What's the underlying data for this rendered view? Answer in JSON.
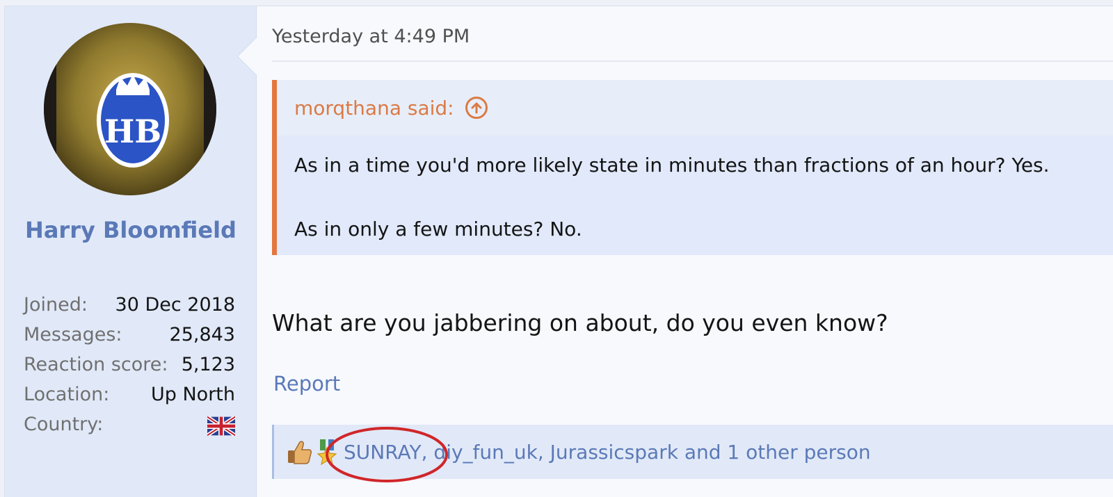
{
  "user": {
    "name": "Harry Bloomfield",
    "stats": [
      {
        "label": "Joined:",
        "value": "30 Dec 2018"
      },
      {
        "label": "Messages:",
        "value": "25,843"
      },
      {
        "label": "Reaction score:",
        "value": "5,123"
      },
      {
        "label": "Location:",
        "value": "Up North"
      },
      {
        "label": "Country:",
        "value": ""
      }
    ],
    "avatar_text": "HB",
    "country_flag": "uk-flag-icon"
  },
  "post": {
    "timestamp": "Yesterday at 4:49 PM",
    "quote": {
      "author_said": "morqthana said:",
      "lines": [
        "As in a time you'd more likely state in minutes than fractions of an hour? Yes.",
        "As in only a few minutes? No."
      ]
    },
    "body": "What are you jabbering on about, do you even know?",
    "report_label": "Report",
    "reactions": {
      "icons": [
        "thumbs-up-icon",
        "medal-icon"
      ],
      "text": "SUNRAY, diy_fun_uk, Jurassicspark and 1 other person"
    }
  },
  "colors": {
    "accent": "#5b79b7",
    "quote_accent": "#e2773f",
    "annotation": "#d0262a"
  }
}
